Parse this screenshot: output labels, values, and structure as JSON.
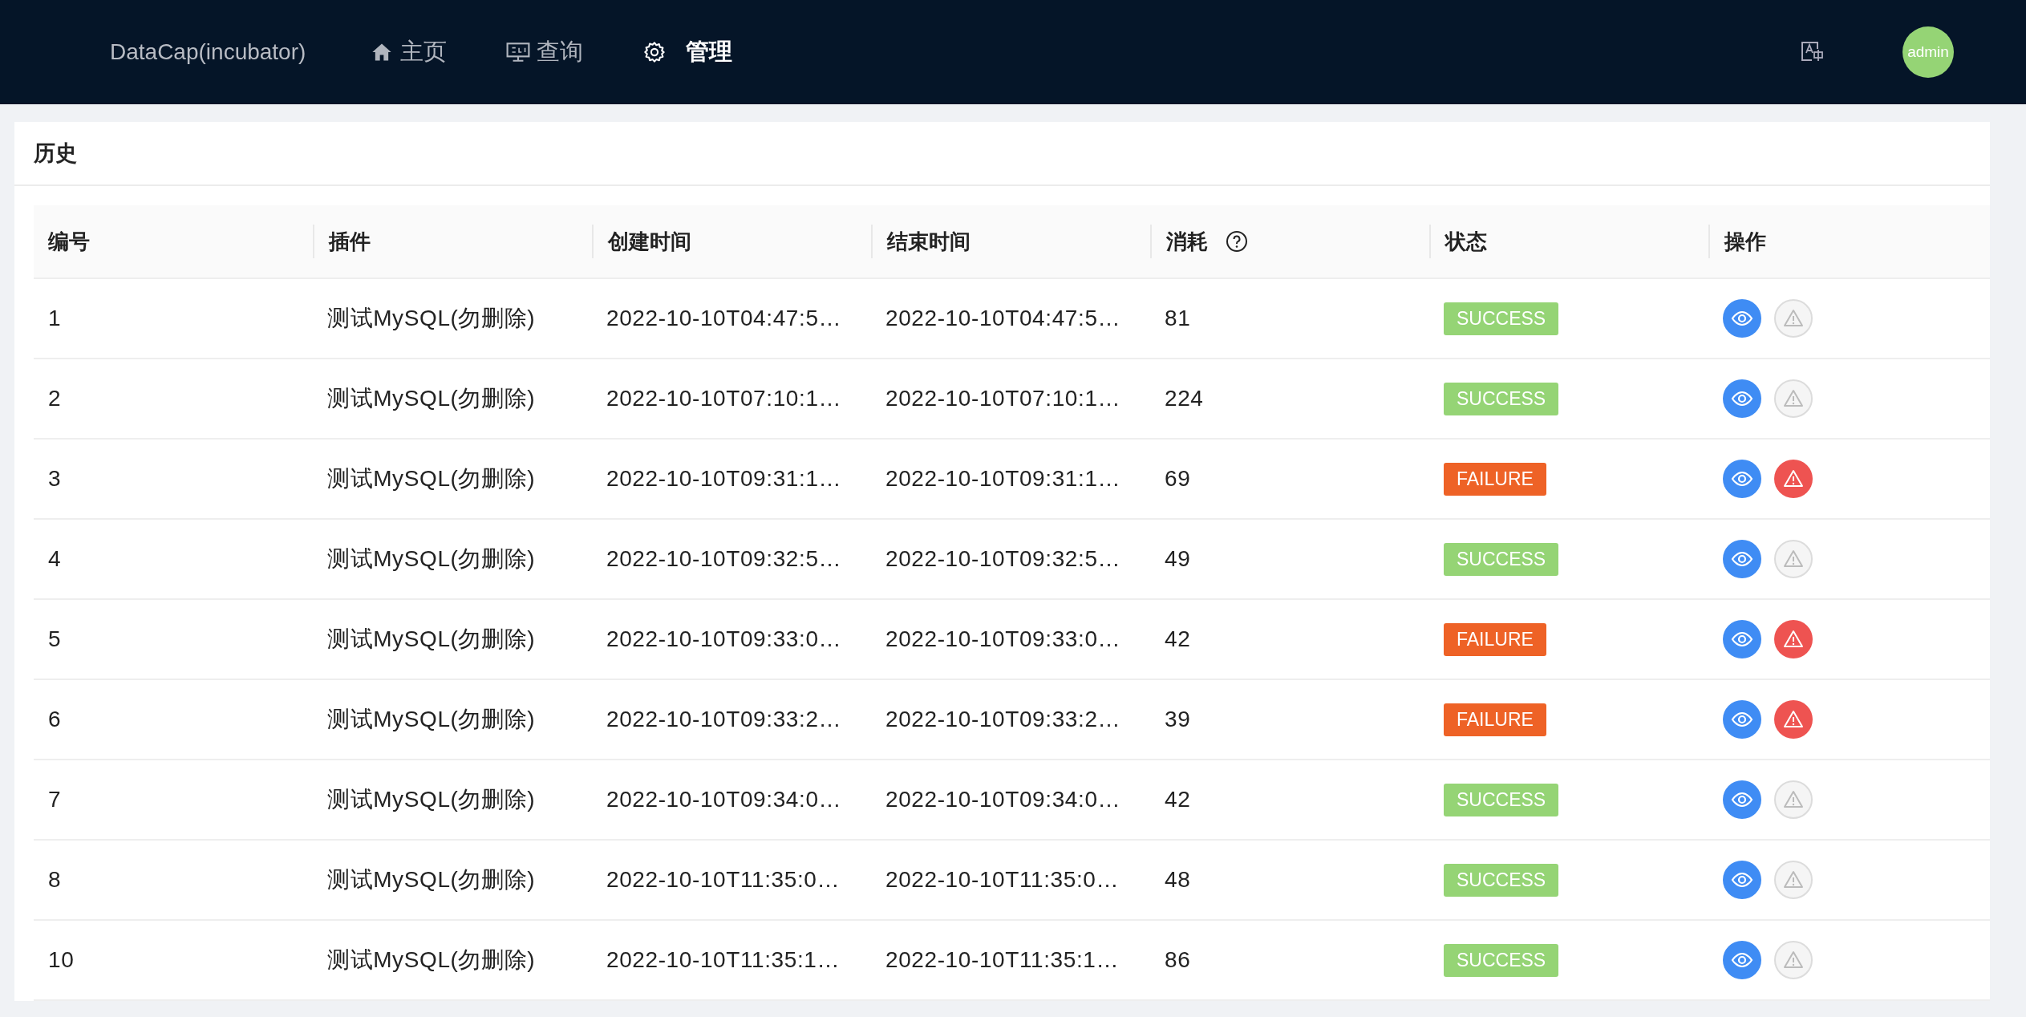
{
  "header": {
    "brand": "DataCap(incubator)",
    "nav": [
      {
        "label": "主页",
        "kind": "home",
        "selected": false
      },
      {
        "label": "查询",
        "kind": "query",
        "selected": false
      },
      {
        "label": "管理",
        "kind": "manage",
        "selected": true
      }
    ],
    "avatar": "admin"
  },
  "card": {
    "title": "历史",
    "columns": [
      {
        "label": "编号"
      },
      {
        "label": "插件"
      },
      {
        "label": "创建时间"
      },
      {
        "label": "结束时间"
      },
      {
        "label": "消耗",
        "help": true
      },
      {
        "label": "状态"
      },
      {
        "label": "操作"
      }
    ],
    "rows": [
      {
        "id": "1",
        "plugin": "测试MySQL(勿删除)",
        "created": "2022-10-10T04:47:5…",
        "ended": "2022-10-10T04:47:5…",
        "cost": "81",
        "status": {
          "label": "SUCCESS",
          "kind": "success"
        },
        "error_enabled": false
      },
      {
        "id": "2",
        "plugin": "测试MySQL(勿删除)",
        "created": "2022-10-10T07:10:1…",
        "ended": "2022-10-10T07:10:1…",
        "cost": "224",
        "status": {
          "label": "SUCCESS",
          "kind": "success"
        },
        "error_enabled": false
      },
      {
        "id": "3",
        "plugin": "测试MySQL(勿删除)",
        "created": "2022-10-10T09:31:1…",
        "ended": "2022-10-10T09:31:1…",
        "cost": "69",
        "status": {
          "label": "FAILURE",
          "kind": "failure"
        },
        "error_enabled": true
      },
      {
        "id": "4",
        "plugin": "测试MySQL(勿删除)",
        "created": "2022-10-10T09:32:5…",
        "ended": "2022-10-10T09:32:5…",
        "cost": "49",
        "status": {
          "label": "SUCCESS",
          "kind": "success"
        },
        "error_enabled": false
      },
      {
        "id": "5",
        "plugin": "测试MySQL(勿删除)",
        "created": "2022-10-10T09:33:0…",
        "ended": "2022-10-10T09:33:0…",
        "cost": "42",
        "status": {
          "label": "FAILURE",
          "kind": "failure"
        },
        "error_enabled": true
      },
      {
        "id": "6",
        "plugin": "测试MySQL(勿删除)",
        "created": "2022-10-10T09:33:2…",
        "ended": "2022-10-10T09:33:2…",
        "cost": "39",
        "status": {
          "label": "FAILURE",
          "kind": "failure"
        },
        "error_enabled": true
      },
      {
        "id": "7",
        "plugin": "测试MySQL(勿删除)",
        "created": "2022-10-10T09:34:0…",
        "ended": "2022-10-10T09:34:0…",
        "cost": "42",
        "status": {
          "label": "SUCCESS",
          "kind": "success"
        },
        "error_enabled": false
      },
      {
        "id": "8",
        "plugin": "测试MySQL(勿删除)",
        "created": "2022-10-10T11:35:0…",
        "ended": "2022-10-10T11:35:0…",
        "cost": "48",
        "status": {
          "label": "SUCCESS",
          "kind": "success"
        },
        "error_enabled": false
      },
      {
        "id": "10",
        "plugin": "测试MySQL(勿删除)",
        "created": "2022-10-10T11:35:1…",
        "ended": "2022-10-10T11:35:1…",
        "cost": "86",
        "status": {
          "label": "SUCCESS",
          "kind": "success"
        },
        "error_enabled": false
      }
    ]
  }
}
